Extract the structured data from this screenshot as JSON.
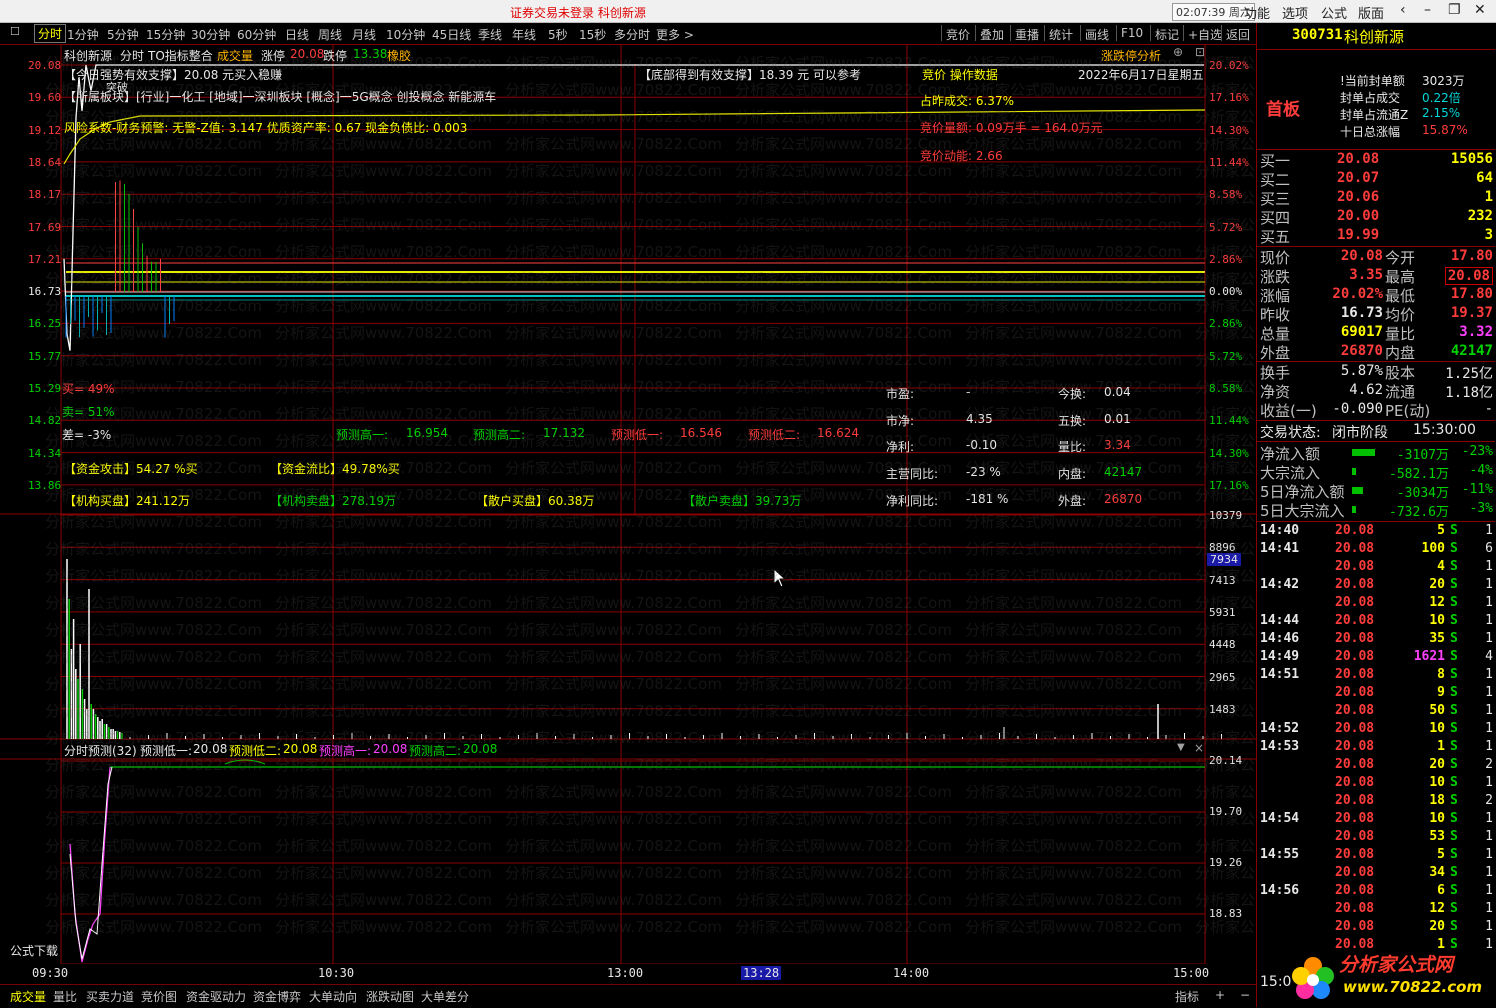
{
  "topbar": {
    "title": "证券交易未登录  科创新源",
    "clock": "02:07:39 周六",
    "menus": [
      "功能",
      "选项",
      "公式",
      "版面"
    ]
  },
  "periods": [
    "分时",
    "1分钟",
    "5分钟",
    "15分钟",
    "30分钟",
    "60分钟",
    "日线",
    "周线",
    "月线",
    "10分钟",
    "45日线",
    "季线",
    "年线",
    "5秒",
    "15秒",
    "多分时",
    "更多 >"
  ],
  "tools": [
    "竞价",
    "叠加",
    "重播",
    "统计",
    "画线",
    "F10",
    "标记",
    "+自选",
    "返回"
  ],
  "header": {
    "name": "科创新源",
    "items": [
      "分时",
      "TO指标整合"
    ],
    "vol_label": "成交量",
    "limit_up_label": "涨停",
    "limit_up": "20.08",
    "limit_down_label": "跌停",
    "limit_down": "13.38",
    "concept": "橡胶",
    "analysis": "涨跌停分析"
  },
  "info": {
    "strong": "【今日强势有效支撑】20.08 元买入稳赚",
    "bottom": "【底部得到有效支撑】18.39 元 可以参考",
    "auction_title": "竞价 操作数据",
    "date": "2022年6月17日星期五",
    "sector": "【所属板块】[行业]一化工 [地域]一深圳板块 [概念]一5G概念 创投概念 新能源车",
    "risk": "风险系数-财务预警: 无警-Z值: 3.147 优质资产率: 0.67 现金负债比: 0.003",
    "auction_ratio": "占昨成交: 6.37%",
    "auction_amount": "竞价量额: 0.09万手 = 164.0万元",
    "auction_power": "竞价动能: 2.66",
    "tag": "突破",
    "buy": "买= 49%",
    "sell": "卖= 51%",
    "diff": "差= -3%",
    "pred_high1_label": "预测高一:",
    "pred_high1": "16.954",
    "pred_high2_label": "预测高二:",
    "pred_high2": "17.132",
    "pred_low1_label": "预测低一:",
    "pred_low1": "16.546",
    "pred_low2_label": "预测低二:",
    "pred_low2": "16.624",
    "fund_attack": "【资金攻击】54.27 %买",
    "fund_flow": "【资金流比】49.78%买",
    "inst_buy": "【机构买盘】241.12万",
    "inst_sell": "【机构卖盘】278.19万",
    "retail_buy": "【散户买盘】60.38万",
    "retail_sell": "【散户卖盘】39.73万",
    "pe_label": "市盈:",
    "pe": "-",
    "pb_label": "市净:",
    "pb": "4.35",
    "profit_label": "净利:",
    "profit": "-0.10",
    "rev_yoy_label": "主营同比:",
    "rev_yoy": "-23 %",
    "profit_yoy_label": "净利同比:",
    "profit_yoy": "-181 %",
    "turnover_label": "今换:",
    "turnover": "0.04",
    "turn5_label": "五换:",
    "turn5": "0.01",
    "vol_ratio_label": "量比:",
    "vol_ratio": "3.34",
    "inner_label": "内盘:",
    "inner": "42147",
    "outer_label": "外盘:",
    "outer": "26870"
  },
  "price_axis": [
    "20.08",
    "19.60",
    "19.12",
    "18.64",
    "18.17",
    "17.69",
    "17.21",
    "16.73",
    "16.25",
    "15.77",
    "15.29",
    "14.82",
    "14.34",
    "13.86"
  ],
  "pct_axis": [
    "20.02%",
    "17.16%",
    "14.30%",
    "11.44%",
    "8.58%",
    "5.72%",
    "2.86%",
    "0.00%",
    "2.86%",
    "5.72%",
    "8.58%",
    "11.44%",
    "14.30%",
    "17.16%"
  ],
  "vol_axis": [
    "10379",
    "8896",
    "7413",
    "5931",
    "4448",
    "2965",
    "1483"
  ],
  "vol_cursor": "7934",
  "forecast": {
    "title": "分时预测(32)",
    "low1_label": "预测低一:",
    "low1": "20.08",
    "low2_label": "预测低二:",
    "low2": "20.08",
    "high1_label": "预测高一:",
    "high1": "20.08",
    "high2_label": "预测高二:",
    "high2": "20.08",
    "axis": [
      "20.14",
      "19.70",
      "19.26",
      "18.83"
    ]
  },
  "time_axis": [
    "09:30",
    "10:30",
    "13:00",
    "13:28",
    "14:00",
    "15:00"
  ],
  "formula_download": "公式下载",
  "bottom_tabs": [
    "成交量",
    "量比",
    "买卖力道",
    "竞价图",
    "资金驱动力",
    "资金博弈",
    "大单动向",
    "涨跌动图",
    "大单差分"
  ],
  "bottom_right": [
    "指标",
    "+"
  ],
  "watermark": "分析家公式网www.70822.Com",
  "chart_data": {
    "type": "line",
    "title": "",
    "x": [
      "09:30",
      "09:31",
      "09:32",
      "09:33",
      "09:34",
      "09:35",
      "09:36",
      "09:37",
      "09:38",
      "09:39",
      "09:40",
      "09:45",
      "10:00",
      "10:30",
      "13:00",
      "14:00",
      "15:00"
    ],
    "series": [
      {
        "values": [
          17.21,
          16.1,
          15.85,
          17.6,
          19.3,
          19.9,
          19.4,
          20.08,
          19.7,
          20.08,
          20.08,
          20.08,
          20.08,
          20.08,
          20.08,
          20.08,
          20.08
        ]
      }
    ],
    "ylim": [
      13.86,
      20.08
    ]
  },
  "quote": {
    "code": "300731",
    "name": "科创新源",
    "status": "首板",
    "seal_amount_label": "!当前封单额",
    "seal_amount": "3023万",
    "seal_ratio_label": "封单占成交",
    "seal_ratio": "0.22倍",
    "seal_float_label": "封单占流通Z",
    "seal_float": "2.15%",
    "ten_day_label": "十日总涨幅",
    "ten_day": "15.87%",
    "bids": [
      {
        "label": "买一",
        "price": "20.08",
        "vol": "15056"
      },
      {
        "label": "买二",
        "price": "20.07",
        "vol": "64"
      },
      {
        "label": "买三",
        "price": "20.06",
        "vol": "1"
      },
      {
        "label": "买四",
        "price": "20.00",
        "vol": "232"
      },
      {
        "label": "买五",
        "price": "19.99",
        "vol": "3"
      }
    ],
    "stats": [
      {
        "l1": "现价",
        "v1": "20.08",
        "l2": "今开",
        "v2": "17.80"
      },
      {
        "l1": "涨跌",
        "v1": "3.35",
        "l2": "最高",
        "v2": "20.08"
      },
      {
        "l1": "涨幅",
        "v1": "20.02%",
        "l2": "最低",
        "v2": "17.80"
      },
      {
        "l1": "昨收",
        "v1": "16.73",
        "l2": "均价",
        "v2": "19.37"
      },
      {
        "l1": "总量",
        "v1": "69017",
        "l2": "量比",
        "v2": "3.32"
      },
      {
        "l1": "外盘",
        "v1": "26870",
        "l2": "内盘",
        "v2": "42147"
      }
    ],
    "stats2": [
      {
        "l1": "换手",
        "v1": "5.87%",
        "l2": "股本",
        "v2": "1.25亿"
      },
      {
        "l1": "净资",
        "v1": "4.62",
        "l2": "流通",
        "v2": "1.18亿"
      },
      {
        "l1": "收益(一)",
        "v1": "-0.090",
        "l2": "PE(动)",
        "v2": "-"
      }
    ],
    "trade_status_label": "交易状态:",
    "trade_status": "闭市阶段",
    "trade_time": "15:30:00",
    "flows": [
      {
        "label": "净流入额",
        "value": "-3107万",
        "pct": "-23%",
        "bar": 0.23
      },
      {
        "label": "大宗流入",
        "value": "-582.1万",
        "pct": "-4%",
        "bar": 0.04
      },
      {
        "label": "5日净流入额",
        "value": "-3034万",
        "pct": "-11%",
        "bar": 0.11
      },
      {
        "label": "5日大宗流入",
        "value": "-732.6万",
        "pct": "-3%",
        "bar": 0.03
      }
    ],
    "ticks": [
      {
        "t": "14:40",
        "p": "20.08",
        "v": "5",
        "s": "S",
        "n": "1"
      },
      {
        "t": "14:41",
        "p": "20.08",
        "v": "100",
        "s": "S",
        "n": "6"
      },
      {
        "t": "",
        "p": "20.08",
        "v": "4",
        "s": "S",
        "n": "1"
      },
      {
        "t": "14:42",
        "p": "20.08",
        "v": "20",
        "s": "S",
        "n": "1"
      },
      {
        "t": "",
        "p": "20.08",
        "v": "12",
        "s": "S",
        "n": "1"
      },
      {
        "t": "14:44",
        "p": "20.08",
        "v": "10",
        "s": "S",
        "n": "1"
      },
      {
        "t": "14:46",
        "p": "20.08",
        "v": "35",
        "s": "S",
        "n": "1"
      },
      {
        "t": "14:49",
        "p": "20.08",
        "v": "1621",
        "s": "S",
        "n": "4"
      },
      {
        "t": "14:51",
        "p": "20.08",
        "v": "8",
        "s": "S",
        "n": "1"
      },
      {
        "t": "",
        "p": "20.08",
        "v": "9",
        "s": "S",
        "n": "1"
      },
      {
        "t": "",
        "p": "20.08",
        "v": "50",
        "s": "S",
        "n": "1"
      },
      {
        "t": "14:52",
        "p": "20.08",
        "v": "10",
        "s": "S",
        "n": "1"
      },
      {
        "t": "14:53",
        "p": "20.08",
        "v": "1",
        "s": "S",
        "n": "1"
      },
      {
        "t": "",
        "p": "20.08",
        "v": "20",
        "s": "S",
        "n": "2"
      },
      {
        "t": "",
        "p": "20.08",
        "v": "10",
        "s": "S",
        "n": "1"
      },
      {
        "t": "",
        "p": "20.08",
        "v": "18",
        "s": "S",
        "n": "2"
      },
      {
        "t": "14:54",
        "p": "20.08",
        "v": "10",
        "s": "S",
        "n": "1"
      },
      {
        "t": "",
        "p": "20.08",
        "v": "53",
        "s": "S",
        "n": "1"
      },
      {
        "t": "14:55",
        "p": "20.08",
        "v": "5",
        "s": "S",
        "n": "1"
      },
      {
        "t": "",
        "p": "20.08",
        "v": "34",
        "s": "S",
        "n": "1"
      },
      {
        "t": "14:56",
        "p": "20.08",
        "v": "6",
        "s": "S",
        "n": "1"
      },
      {
        "t": "",
        "p": "20.08",
        "v": "12",
        "s": "S",
        "n": "1"
      },
      {
        "t": "",
        "p": "20.08",
        "v": "20",
        "s": "S",
        "n": "1"
      },
      {
        "t": "",
        "p": "20.08",
        "v": "1",
        "s": "S",
        "n": "1"
      }
    ],
    "last_time": "15:0",
    "logo_text": "分析家公式网",
    "logo_url": "www.70822.com"
  }
}
